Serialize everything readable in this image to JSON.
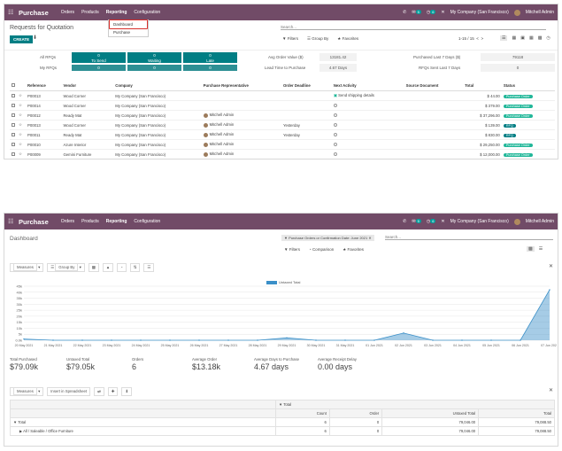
{
  "app": {
    "name": "Purchase",
    "menus": [
      "Orders",
      "Products",
      "Reporting",
      "Configuration"
    ],
    "badges": [
      "5",
      "6"
    ],
    "company": "My Company (San Francisco)",
    "user": "Mitchell Admin"
  },
  "reporting_dropdown": {
    "items": [
      "Dashboard",
      "Purchase"
    ]
  },
  "list": {
    "title": "Requests for Quotation",
    "create_label": "CREATE",
    "search_placeholder": "Search...",
    "filters_label": "Filters",
    "group_by_label": "Group By",
    "favorites_label": "Favorites",
    "pager": "1-15 / 15",
    "stats": {
      "all_rfqs_label": "All RFQs",
      "my_rfqs_label": "My RFQs",
      "tiles": [
        {
          "count": "0",
          "label": "To Send",
          "my": "0"
        },
        {
          "count": "0",
          "label": "Waiting",
          "my": "0"
        },
        {
          "count": "0",
          "label": "Late",
          "my": "0"
        }
      ],
      "avg_order_label": "Avg Order Value ($)",
      "avg_order_value": "13181.42",
      "lead_time_label": "Lead Time to Purchase",
      "lead_time_value": "4.67 Days",
      "purchased_label": "Purchased Last 7 Days ($)",
      "purchased_value": "79118",
      "rfq_sent_label": "RFQs Sent Last 7 Days",
      "rfq_sent_value": "0"
    },
    "columns": [
      "Reference",
      "Vendor",
      "Company",
      "Purchase Representative",
      "Order Deadline",
      "Next Activity",
      "Source Document",
      "Total",
      "Status"
    ],
    "rows": [
      {
        "ref": "P00013",
        "vendor": "Wood Corner",
        "company": "My Company (San Francisco)",
        "rep": "",
        "deadline": "",
        "activity": "Send shipping details",
        "source": "",
        "total": "$ 44.00",
        "status": "Purchase Order",
        "status_kind": "po",
        "muted": false
      },
      {
        "ref": "P00014",
        "vendor": "Wood Corner",
        "company": "My Company (San Francisco)",
        "rep": "",
        "deadline": "",
        "activity": "",
        "source": "",
        "total": "$ 379.00",
        "status": "Purchase Order",
        "status_kind": "po",
        "muted": false
      },
      {
        "ref": "P00012",
        "vendor": "Ready Mat",
        "company": "My Company (San Francisco)",
        "rep": "Mitchell Admin",
        "deadline": "",
        "activity": "",
        "source": "",
        "total": "$ 37,296.00",
        "status": "Purchase Order",
        "status_kind": "po",
        "muted": false
      },
      {
        "ref": "P00013",
        "vendor": "Wood Corner",
        "company": "My Company (San Francisco)",
        "rep": "Mitchell Admin",
        "deadline": "Yesterday",
        "activity": "",
        "source": "",
        "total": "$ 139.00",
        "status": "RFQ",
        "status_kind": "rfq",
        "muted": true
      },
      {
        "ref": "P00011",
        "vendor": "Ready Mat",
        "company": "My Company (San Francisco)",
        "rep": "Mitchell Admin",
        "deadline": "Yesterday",
        "activity": "",
        "source": "",
        "total": "$ 830.00",
        "status": "RFQ",
        "status_kind": "rfq",
        "muted": true
      },
      {
        "ref": "P00010",
        "vendor": "Azure Interior",
        "company": "My Company (San Francisco)",
        "rep": "Mitchell Admin",
        "deadline": "",
        "activity": "",
        "source": "",
        "total": "$ 29,250.00",
        "status": "Purchase Order",
        "status_kind": "po",
        "muted": false
      },
      {
        "ref": "P00009",
        "vendor": "Gemini Furniture",
        "company": "My Company (San Francisco)",
        "rep": "Mitchell Admin",
        "deadline": "",
        "activity": "",
        "source": "",
        "total": "$ 12,000.00",
        "status": "Purchase Order",
        "status_kind": "po",
        "muted": false
      }
    ]
  },
  "dashboard": {
    "title": "Dashboard",
    "facet": "Purchase Orders or Confirmation Date: June 2021",
    "search_placeholder": "Search...",
    "filters_label": "Filters",
    "comparison_label": "Comparison",
    "favorites_label": "Favorites",
    "measures_label": "Measures",
    "group_by_label": "Group By",
    "kpis": [
      {
        "label": "Total Purchased",
        "value": "$79.09k"
      },
      {
        "label": "Untaxed Total",
        "value": "$79.05k"
      },
      {
        "label": "Orders",
        "value": "6"
      },
      {
        "label": "Average Order",
        "value": "$13.18k"
      },
      {
        "label": "Average Days to Purchase",
        "value": "4.67 days"
      },
      {
        "label": "Average Receipt Delay",
        "value": "0.00 days"
      }
    ],
    "pivot": {
      "insert_label": "Insert in Spreadsheet",
      "header_total": "Total",
      "col_headers": [
        "Count",
        "Order",
        "Untaxed Total",
        "Total"
      ],
      "rows": [
        {
          "label": "Total",
          "values": [
            "6",
            "0",
            "79,046.00",
            "79,088.50"
          ]
        },
        {
          "label": "All / Saleable / Office Furniture",
          "values": [
            "6",
            "0",
            "79,046.00",
            "79,088.50"
          ]
        }
      ]
    }
  },
  "chart_data": {
    "type": "area",
    "series": [
      {
        "name": "Untaxed Total"
      }
    ],
    "x": [
      "20 May 2021",
      "21 May 2021",
      "22 May 2021",
      "23 May 2021",
      "24 May 2021",
      "25 May 2021",
      "26 May 2021",
      "27 May 2021",
      "28 May 2021",
      "29 May 2021",
      "30 May 2021",
      "31 May 2021",
      "01 Jun 2021",
      "02 Jun 2021",
      "03 Jun 2021",
      "04 Jun 2021",
      "05 Jun 2021",
      "06 Jun 2021",
      "07 Jun 2021"
    ],
    "values": [
      1000,
      0,
      0,
      0,
      0,
      0,
      0,
      0,
      0,
      2000,
      0,
      0,
      0,
      6000,
      0,
      0,
      0,
      0,
      42000
    ],
    "yticks": [
      "0.0k",
      "5k",
      "10k",
      "15k",
      "20k",
      "25k",
      "30k",
      "35k",
      "40k",
      "45k"
    ],
    "ylim": [
      0,
      45000
    ],
    "colors": {
      "series": "#3a8fc8"
    }
  }
}
